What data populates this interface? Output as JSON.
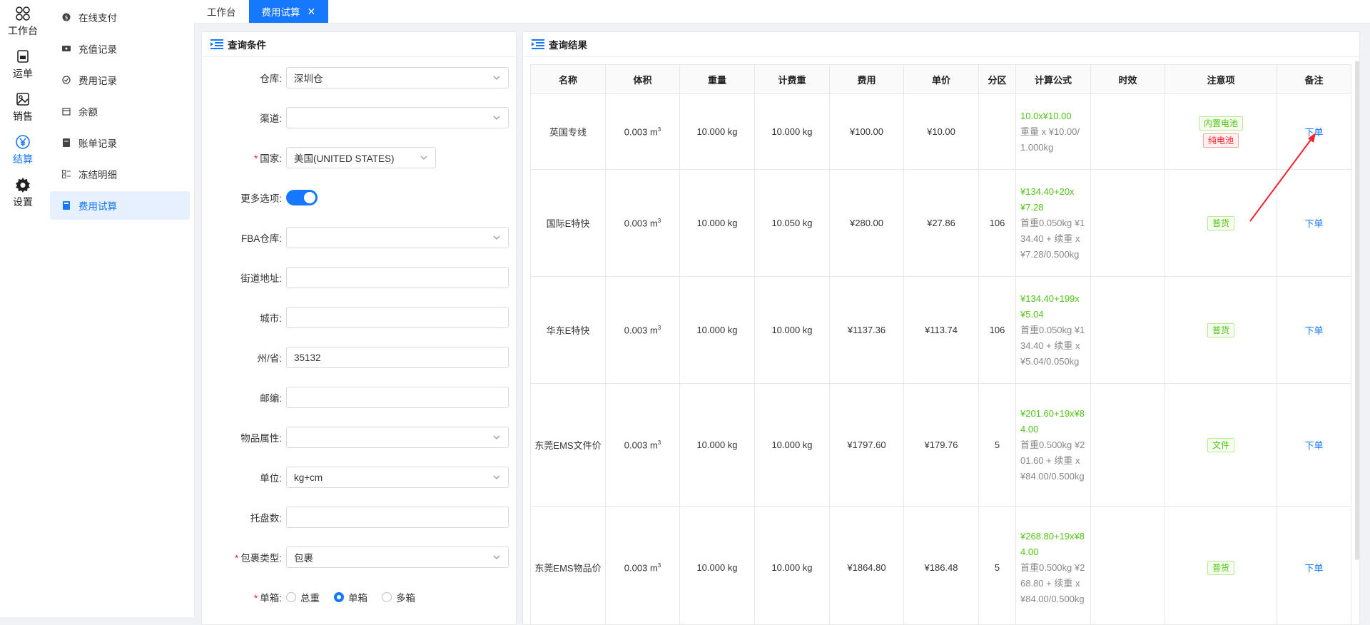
{
  "rail": [
    {
      "label": "工作台",
      "icon": "workbench-icon"
    },
    {
      "label": "运单",
      "icon": "waybill-icon"
    },
    {
      "label": "销售",
      "icon": "sales-icon"
    },
    {
      "label": "结算",
      "icon": "settlement-icon",
      "active": true
    },
    {
      "label": "设置",
      "icon": "gear-icon"
    }
  ],
  "sidebar": {
    "items": [
      {
        "label": "在线支付"
      },
      {
        "label": "充值记录"
      },
      {
        "label": "费用记录"
      },
      {
        "label": "余额"
      },
      {
        "label": "账单记录"
      },
      {
        "label": "冻结明细"
      },
      {
        "label": "费用试算",
        "active": true
      }
    ]
  },
  "tabs": [
    {
      "label": "工作台"
    },
    {
      "label": "费用试算",
      "active": true
    }
  ],
  "query": {
    "title": "查询条件",
    "fields": {
      "warehouse": {
        "label": "仓库",
        "value": "深圳仓"
      },
      "channel": {
        "label": "渠道",
        "value": ""
      },
      "country": {
        "label": "国家",
        "value": "美国(UNITED STATES)"
      },
      "more": {
        "label": "更多选项"
      },
      "fba": {
        "label": "FBA仓库",
        "value": ""
      },
      "street": {
        "label": "街道地址",
        "value": ""
      },
      "city": {
        "label": "城市",
        "value": ""
      },
      "state": {
        "label": "州/省",
        "value": "35132"
      },
      "zip": {
        "label": "邮编",
        "value": ""
      },
      "attr": {
        "label": "物品属性",
        "value": ""
      },
      "unit": {
        "label": "单位",
        "value": "kg+cm"
      },
      "pallet": {
        "label": "托盘数",
        "value": ""
      },
      "pkg": {
        "label": "包裹类型",
        "value": "包裹"
      },
      "box": {
        "label": "单箱",
        "options": [
          "总重",
          "单箱",
          "多箱"
        ],
        "selected": "单箱"
      }
    }
  },
  "result": {
    "title": "查询结果",
    "columns": [
      "名称",
      "体积",
      "重量",
      "计费重",
      "费用",
      "单价",
      "分区",
      "计算公式",
      "时效",
      "注意项",
      "备注"
    ],
    "vol_unit": "m",
    "vol_exp": "3",
    "rows": [
      {
        "name": "英国专线",
        "volume": "0.003",
        "weight": "10.000 kg",
        "charge_weight": "10.000 kg",
        "fee": "¥100.00",
        "unit_price": "¥10.00",
        "zone": "",
        "formula_main": "10.0x¥10.00",
        "formula_detail": "重量 x ¥10.00/1.000kg",
        "tags": [
          {
            "text": "内置电池",
            "color": "green"
          },
          {
            "text": "纯电池",
            "color": "red"
          }
        ],
        "action": "下单"
      },
      {
        "name": "国际E特快",
        "volume": "0.003",
        "weight": "10.000 kg",
        "charge_weight": "10.050 kg",
        "fee": "¥280.00",
        "unit_price": "¥27.86",
        "zone": "106",
        "formula_main": "¥134.40+20x¥7.28",
        "formula_detail": "首重0.050kg ¥134.40 + 续重 x ¥7.28/0.500kg",
        "tags": [
          {
            "text": "普货",
            "color": "green"
          }
        ],
        "action": "下单"
      },
      {
        "name": "华东E特快",
        "volume": "0.003",
        "weight": "10.000 kg",
        "charge_weight": "10.000 kg",
        "fee": "¥1137.36",
        "unit_price": "¥113.74",
        "zone": "106",
        "formula_main": "¥134.40+199x¥5.04",
        "formula_detail": "首重0.050kg ¥134.40 + 续重 x ¥5.04/0.050kg",
        "tags": [
          {
            "text": "普货",
            "color": "green"
          }
        ],
        "action": "下单"
      },
      {
        "name": "东莞EMS文件价",
        "volume": "0.003",
        "weight": "10.000 kg",
        "charge_weight": "10.000 kg",
        "fee": "¥1797.60",
        "unit_price": "¥179.76",
        "zone": "5",
        "formula_main": "¥201.60+19x¥84.00",
        "formula_detail": "首重0.500kg ¥201.60 + 续重 x ¥84.00/0.500kg",
        "tags": [
          {
            "text": "文件",
            "color": "green"
          }
        ],
        "action": "下单"
      },
      {
        "name": "东莞EMS物品价",
        "volume": "0.003",
        "weight": "10.000 kg",
        "charge_weight": "10.000 kg",
        "fee": "¥1864.80",
        "unit_price": "¥186.48",
        "zone": "5",
        "formula_main": "¥268.80+19x¥84.00",
        "formula_detail": "首重0.500kg ¥268.80 + 续重 x ¥84.00/0.500kg",
        "tags": [
          {
            "text": "普货",
            "color": "green"
          }
        ],
        "action": "下单"
      }
    ]
  }
}
